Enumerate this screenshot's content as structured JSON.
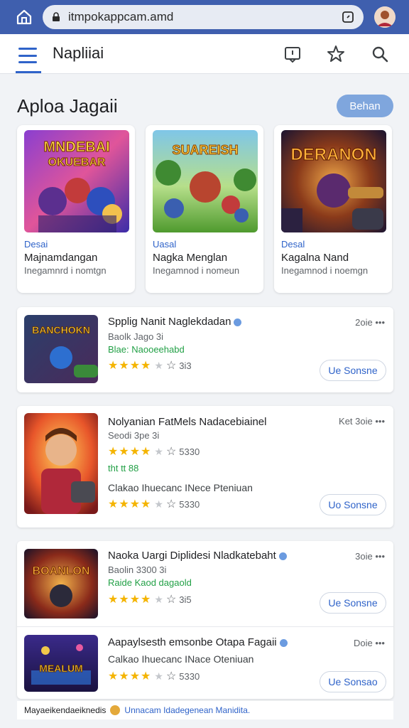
{
  "browser": {
    "url": "itmpokappcam.amd",
    "icons": [
      "home-icon",
      "lock-icon",
      "tabs-icon",
      "avatar"
    ]
  },
  "appbar": {
    "title": "Napliiai",
    "icons": [
      "menu-icon",
      "feedback-icon",
      "star-icon",
      "search-icon"
    ]
  },
  "featured": {
    "title": "Aploa Jagaii",
    "button": "Behan",
    "cards": [
      {
        "category": "Desai",
        "name": "Majnamdangan",
        "sub": "Inegamnrd i nomtgn",
        "art": "MNDEBAI\nOKUEBAR"
      },
      {
        "category": "Uasal",
        "name": "Nagka Menglan",
        "sub": "Inegamnod i nomeun",
        "art": "SUAREISH"
      },
      {
        "category": "Desal",
        "name": "Kagalna Nand",
        "sub": "Inegamnod i noemgn",
        "art": "DERANON"
      }
    ]
  },
  "list": [
    {
      "title": "Spplig Nanit Naglekdadan",
      "meta": "2oie •••",
      "sub": "Baolk Jago 3i",
      "green": "Blae: Naooeehabd",
      "rating": "3i3",
      "button": "Ue Sonsne",
      "art": "BANCHOKN"
    },
    {
      "title": "Nolyanian FatMels Nadacebiainel",
      "meta": "Ket 3oie •••",
      "sub": "Seodi 3pe 3i",
      "green": "tht tt 88",
      "desc": "Clakao Ihuecanc INece Pteniuan",
      "rating": "5330",
      "button": "Uo Sonsne",
      "art": ""
    },
    {
      "title": "Naoka Uargi Diplidesi Nladkatebaht",
      "meta": "3oie •••",
      "sub": "Baolin 3300 3i",
      "green": "Raide Kaod dagaold",
      "rating": "3i5",
      "button": "Ue Sonsne",
      "art": "BOANLON"
    },
    {
      "title": "Aapaylsesth emsonbe Otapa Fagaii",
      "meta": "Doie •••",
      "desc": "Calkao Ihuecanc INace Oteniuan",
      "rating": "5330",
      "button": "Ue Sonsao",
      "art": "MEALUM"
    }
  ],
  "footer": {
    "text": "Mayaeikendaeiknedis",
    "link": "Unnacam Idadegenean Manidita."
  },
  "colors": {
    "topbar": "#3f5fae",
    "accent": "#2f63c9",
    "star": "#f4b400",
    "green": "#22a046"
  }
}
